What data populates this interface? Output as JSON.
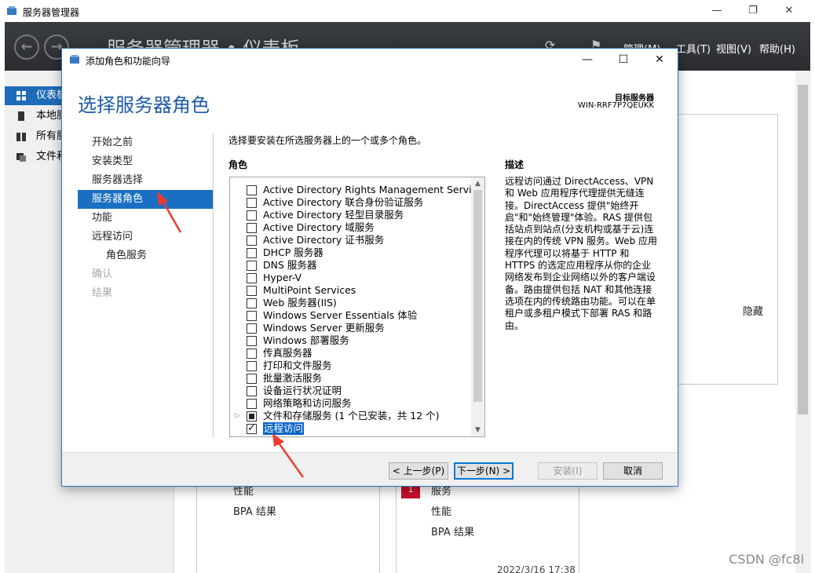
{
  "server_manager": {
    "title": "服务器管理器",
    "breadcrumb": "服务器管理器 • 仪表板",
    "menu": {
      "manage": "管理(M)",
      "tools": "工具(T)",
      "view": "视图(V)",
      "help": "帮助(H)"
    },
    "sidebar": [
      {
        "label": "仪表板",
        "icon": "dashboard-icon",
        "active": true
      },
      {
        "label": "本地服务器",
        "icon": "server-icon",
        "active": false
      },
      {
        "label": "所有服务器",
        "icon": "servers-icon",
        "active": false
      },
      {
        "label": "文件和存储服务",
        "icon": "storage-icon",
        "active": false
      }
    ],
    "tiles": {
      "left_performance": "性能",
      "left_bpa": "BPA 结果",
      "right_services": "服务",
      "right_performance": "性能",
      "right_bpa": "BPA 结果",
      "hide": "隐藏",
      "timestamp": "2022/3/16 17:38",
      "badge_count": "1"
    }
  },
  "wizard": {
    "title": "添加角色和功能向导",
    "heading": "选择服务器角色",
    "target_label": "目标服务器",
    "target_name": "WIN-RRF7P7QEUKK",
    "steps": [
      {
        "label": "开始之前",
        "state": "normal",
        "sub": false
      },
      {
        "label": "安装类型",
        "state": "normal",
        "sub": false
      },
      {
        "label": "服务器选择",
        "state": "normal",
        "sub": false
      },
      {
        "label": "服务器角色",
        "state": "active",
        "sub": false
      },
      {
        "label": "功能",
        "state": "normal",
        "sub": false
      },
      {
        "label": "远程访问",
        "state": "normal",
        "sub": false
      },
      {
        "label": "角色服务",
        "state": "normal",
        "sub": true
      },
      {
        "label": "确认",
        "state": "disabled",
        "sub": false
      },
      {
        "label": "结果",
        "state": "disabled",
        "sub": false
      }
    ],
    "instruction": "选择要安装在所选服务器上的一个或多个角色。",
    "roles_label": "角色",
    "description_label": "描述",
    "roles": [
      {
        "label": "Active Directory Rights Management Services",
        "state": "unchecked"
      },
      {
        "label": "Active Directory 联合身份验证服务",
        "state": "unchecked"
      },
      {
        "label": "Active Directory 轻型目录服务",
        "state": "unchecked"
      },
      {
        "label": "Active Directory 域服务",
        "state": "unchecked"
      },
      {
        "label": "Active Directory 证书服务",
        "state": "unchecked"
      },
      {
        "label": "DHCP 服务器",
        "state": "unchecked"
      },
      {
        "label": "DNS 服务器",
        "state": "unchecked"
      },
      {
        "label": "Hyper-V",
        "state": "unchecked"
      },
      {
        "label": "MultiPoint Services",
        "state": "unchecked"
      },
      {
        "label": "Web 服务器(IIS)",
        "state": "unchecked"
      },
      {
        "label": "Windows Server Essentials 体验",
        "state": "unchecked"
      },
      {
        "label": "Windows Server 更新服务",
        "state": "unchecked"
      },
      {
        "label": "Windows 部署服务",
        "state": "unchecked"
      },
      {
        "label": "传真服务器",
        "state": "unchecked"
      },
      {
        "label": "打印和文件服务",
        "state": "unchecked"
      },
      {
        "label": "批量激活服务",
        "state": "unchecked"
      },
      {
        "label": "设备运行状况证明",
        "state": "unchecked"
      },
      {
        "label": "网络策略和访问服务",
        "state": "unchecked"
      },
      {
        "label": "文件和存储服务 (1 个已安装，共 12 个)",
        "state": "partial",
        "expandable": true
      },
      {
        "label": "远程访问",
        "state": "checked",
        "selected": true
      }
    ],
    "description_lines": [
      "远程访问通过 DirectAccess、VPN",
      "和 Web 应用程序代理提供无缝连",
      "接。DirectAccess 提供\"始终开",
      "启\"和\"始终管理\"体验。RAS 提供包",
      "括站点到站点(分支机构或基于云)连",
      "接在内的传统 VPN 服务。Web 应用",
      "程序代理可以将基于 HTTP 和",
      "HTTPS 的选定应用程序从你的企业",
      "网络发布到企业网络以外的客户端设",
      "备。路由提供包括 NAT 和其他连接",
      "选项在内的传统路由功能。可以在单",
      "租户或多租户模式下部署 RAS 和路",
      "由。"
    ],
    "buttons": {
      "previous": "< 上一步(P)",
      "next": "下一步(N) >",
      "install": "安装(I)",
      "cancel": "取消"
    }
  },
  "watermark": "CSDN @fc8l",
  "colors": {
    "accent": "#1a6fc3",
    "heading": "#1e5aa8",
    "annotation": "#ee3b2f"
  }
}
